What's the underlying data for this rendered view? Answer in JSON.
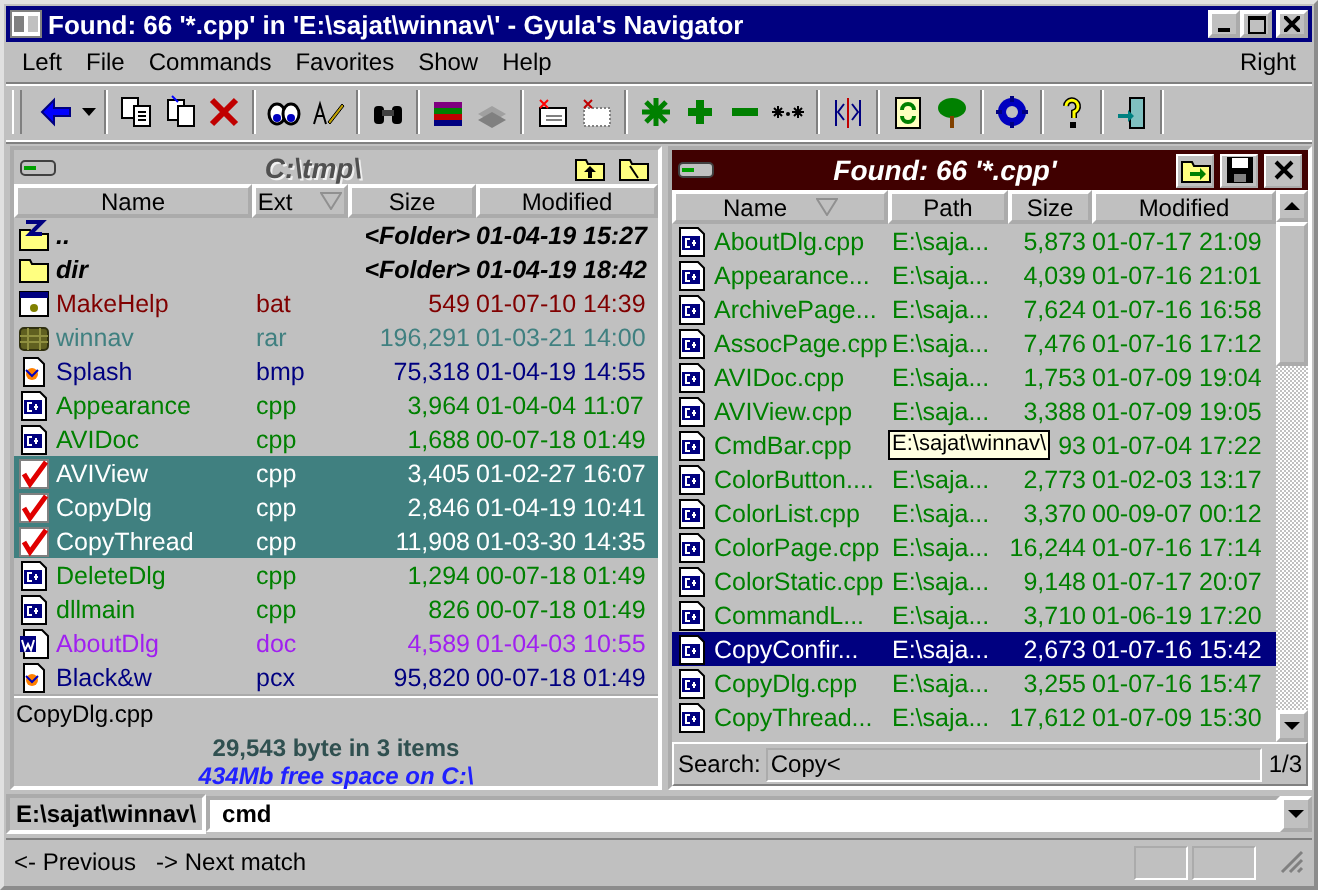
{
  "window": {
    "title": "Found: 66 '*.cpp' in 'E:\\sajat\\winnav\\' - Gyula's Navigator"
  },
  "menu": [
    {
      "label": "Left"
    },
    {
      "label": "File"
    },
    {
      "label": "Commands"
    },
    {
      "label": "Favorites"
    },
    {
      "label": "Show"
    },
    {
      "label": "Help"
    }
  ],
  "menu_right": {
    "label": "Right"
  },
  "left_panel": {
    "path": "C:\\tmp\\",
    "columns": [
      {
        "label": "Name",
        "sorted": false
      },
      {
        "label": "Ext",
        "sorted": true
      },
      {
        "label": "Size",
        "sorted": false
      },
      {
        "label": "Modified",
        "sorted": false
      }
    ],
    "rows": [
      {
        "kind": "up",
        "name": "..",
        "ext": "",
        "size": "<Folder>",
        "modified": "01-04-19 15:27",
        "color": "#000000",
        "marked": false
      },
      {
        "kind": "folder",
        "name": "dir",
        "ext": "",
        "size": "<Folder>",
        "modified": "01-04-19 18:42",
        "color": "#000000",
        "marked": false
      },
      {
        "kind": "bat",
        "name": "MakeHelp",
        "ext": "bat",
        "size": "549",
        "modified": "01-07-10 14:39",
        "color": "#800000",
        "marked": false
      },
      {
        "kind": "rar",
        "name": "winnav",
        "ext": "rar",
        "size": "196,291",
        "modified": "01-03-21 14:00",
        "color": "#408080",
        "marked": false
      },
      {
        "kind": "bmp",
        "name": "Splash",
        "ext": "bmp",
        "size": "75,318",
        "modified": "01-04-19 14:55",
        "color": "#000080",
        "marked": false
      },
      {
        "kind": "cpp",
        "name": "Appearance",
        "ext": "cpp",
        "size": "3,964",
        "modified": "01-04-04 11:07",
        "color": "#008000",
        "marked": false
      },
      {
        "kind": "cpp",
        "name": "AVIDoc",
        "ext": "cpp",
        "size": "1,688",
        "modified": "00-07-18 01:49",
        "color": "#008000",
        "marked": false
      },
      {
        "kind": "cpp",
        "name": "AVIView",
        "ext": "cpp",
        "size": "3,405",
        "modified": "01-02-27 16:07",
        "color": "#ffffff",
        "marked": true
      },
      {
        "kind": "cpp",
        "name": "CopyDlg",
        "ext": "cpp",
        "size": "2,846",
        "modified": "01-04-19 10:41",
        "color": "#ffffff",
        "marked": true
      },
      {
        "kind": "cpp",
        "name": "CopyThread",
        "ext": "cpp",
        "size": "11,908",
        "modified": "01-03-30 14:35",
        "color": "#ffffff",
        "marked": true
      },
      {
        "kind": "cpp",
        "name": "DeleteDlg",
        "ext": "cpp",
        "size": "1,294",
        "modified": "00-07-18 01:49",
        "color": "#008000",
        "marked": false
      },
      {
        "kind": "cpp",
        "name": "dllmain",
        "ext": "cpp",
        "size": "826",
        "modified": "00-07-18 01:49",
        "color": "#008000",
        "marked": false
      },
      {
        "kind": "doc",
        "name": "AboutDlg",
        "ext": "doc",
        "size": "4,589",
        "modified": "01-04-03 10:55",
        "color": "#a020f0",
        "marked": false
      },
      {
        "kind": "bmp",
        "name": "Black&w",
        "ext": "pcx",
        "size": "95,820",
        "modified": "00-07-18 01:49",
        "color": "#000080",
        "marked": false
      }
    ],
    "current_file": "CopyDlg.cpp",
    "summary": "29,543 byte in 3 items",
    "free_space": "434Mb free space on C:\\"
  },
  "right_panel": {
    "title": "Found: 66 '*.cpp'",
    "columns": [
      {
        "label": "Name",
        "sorted": true
      },
      {
        "label": "Path",
        "sorted": false
      },
      {
        "label": "Size",
        "sorted": false
      },
      {
        "label": "Modified",
        "sorted": false
      }
    ],
    "rows": [
      {
        "name": "AboutDlg.cpp",
        "path": "E:\\saja...",
        "size": "5,873",
        "modified": "01-07-17 21:09",
        "selected": false
      },
      {
        "name": "Appearance...",
        "path": "E:\\saja...",
        "size": "4,039",
        "modified": "01-07-16 21:01",
        "selected": false
      },
      {
        "name": "ArchivePage...",
        "path": "E:\\saja...",
        "size": "7,624",
        "modified": "01-07-16 16:58",
        "selected": false
      },
      {
        "name": "AssocPage.cpp",
        "path": "E:\\saja...",
        "size": "7,476",
        "modified": "01-07-16 17:12",
        "selected": false
      },
      {
        "name": "AVIDoc.cpp",
        "path": "E:\\saja...",
        "size": "1,753",
        "modified": "01-07-09 19:04",
        "selected": false
      },
      {
        "name": "AVIView.cpp",
        "path": "E:\\saja...",
        "size": "3,388",
        "modified": "01-07-09 19:05",
        "selected": false
      },
      {
        "name": "CmdBar.cpp",
        "tooltip": "E:\\sajat\\winnav\\",
        "size": "93",
        "modified": "01-07-04 17:22",
        "selected": false
      },
      {
        "name": "ColorButton....",
        "path": "E:\\saja...",
        "size": "2,773",
        "modified": "01-02-03 13:17",
        "selected": false
      },
      {
        "name": "ColorList.cpp",
        "path": "E:\\saja...",
        "size": "3,370",
        "modified": "00-09-07 00:12",
        "selected": false
      },
      {
        "name": "ColorPage.cpp",
        "path": "E:\\saja...",
        "size": "16,244",
        "modified": "01-07-16 17:14",
        "selected": false
      },
      {
        "name": "ColorStatic.cpp",
        "path": "E:\\saja...",
        "size": "9,148",
        "modified": "01-07-17 20:07",
        "selected": false
      },
      {
        "name": "CommandL...",
        "path": "E:\\saja...",
        "size": "3,710",
        "modified": "01-06-19 17:20",
        "selected": false
      },
      {
        "name": "CopyConfir...",
        "path": "E:\\saja...",
        "size": "2,673",
        "modified": "01-07-16 15:42",
        "selected": true
      },
      {
        "name": "CopyDlg.cpp",
        "path": "E:\\saja...",
        "size": "3,255",
        "modified": "01-07-16 15:47",
        "selected": false
      },
      {
        "name": "CopyThread...",
        "path": "E:\\saja...",
        "size": "17,612",
        "modified": "01-07-09 15:30",
        "selected": false
      }
    ],
    "search": {
      "label": "Search:",
      "value": "Copy<",
      "count": "1/3"
    }
  },
  "command_line": {
    "path": "E:\\sajat\\winnav\\",
    "value": "cmd"
  },
  "status_bar": {
    "previous": "<- Previous",
    "next": "-> Next match"
  }
}
